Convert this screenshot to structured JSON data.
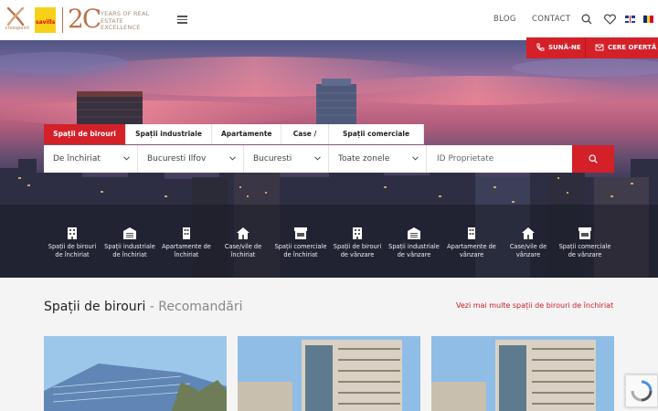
{
  "header": {
    "logo_crosspoint_text": "crosspoint",
    "logo_savills_text": "savills",
    "logo_20_text": "2C",
    "logo_tagline": "YEARS OF REAL ESTATE EXCELLENCE",
    "nav_blog": "BLOG",
    "nav_contact": "CONTACT",
    "icons": [
      "menu-icon",
      "search-icon",
      "heart-icon",
      "flag-uk-icon",
      "flag-ro-icon"
    ]
  },
  "cta": {
    "call_label": "SUNĂ-NE",
    "offer_label": "CERE OFERTĂ",
    "color": "#d42028"
  },
  "tabs": [
    {
      "label": "Spații de birouri",
      "active": true
    },
    {
      "label": "Spații industriale",
      "active": false
    },
    {
      "label": "Apartamente",
      "active": false
    },
    {
      "label": "Case / Vile",
      "active": false
    },
    {
      "label": "Spații comerciale",
      "active": false
    }
  ],
  "search": {
    "transaction": "De închiriat",
    "region": "Bucuresti Ilfov",
    "city": "Bucuresti",
    "zone": "Toate zonele",
    "id_placeholder": "ID Proprietate"
  },
  "categories": [
    {
      "label": "Spații de birouri de închiriat",
      "icon": "office-building-icon"
    },
    {
      "label": "Spații industriale de închiriat",
      "icon": "warehouse-icon"
    },
    {
      "label": "Apartamente de închiriat",
      "icon": "apartment-icon"
    },
    {
      "label": "Case/vile de închiriat",
      "icon": "house-icon"
    },
    {
      "label": "Spații comerciale de închiriat",
      "icon": "shop-icon"
    },
    {
      "label": "Spații de birouri de vânzare",
      "icon": "office-building-icon"
    },
    {
      "label": "Spații industriale de vânzare",
      "icon": "warehouse-icon"
    },
    {
      "label": "Apartamente de vânzare",
      "icon": "apartment-icon"
    },
    {
      "label": "Case/vile de vânzare",
      "icon": "house-icon"
    },
    {
      "label": "Spații comerciale de vânzare",
      "icon": "shop-icon"
    }
  ],
  "section": {
    "title": "Spații de birouri",
    "subtitle": " - Recomandări",
    "link": "Vezi mai multe spații de birouri de închiriat"
  },
  "colors": {
    "accent": "#d42028",
    "brand_bronze": "#b9734b"
  }
}
